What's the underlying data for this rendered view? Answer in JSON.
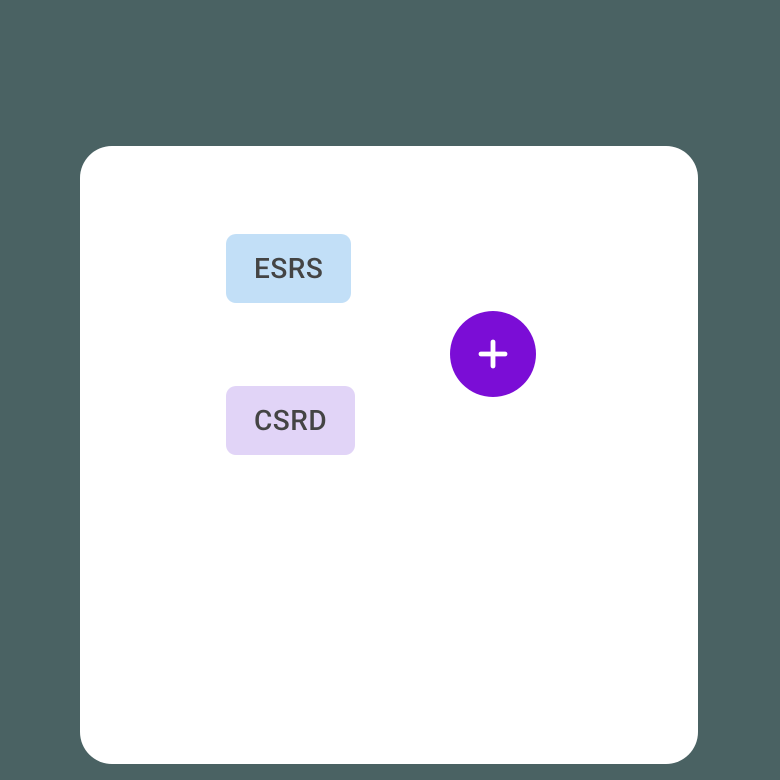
{
  "tags": {
    "esrs": {
      "label": "ESRS"
    },
    "csrd": {
      "label": "CSRD"
    }
  },
  "colors": {
    "background": "#4a6263",
    "card": "#ffffff",
    "tag_esrs": "#c2dff7",
    "tag_csrd": "#e1d4f7",
    "add_button": "#7b0dd6",
    "tag_text": "#444444"
  }
}
